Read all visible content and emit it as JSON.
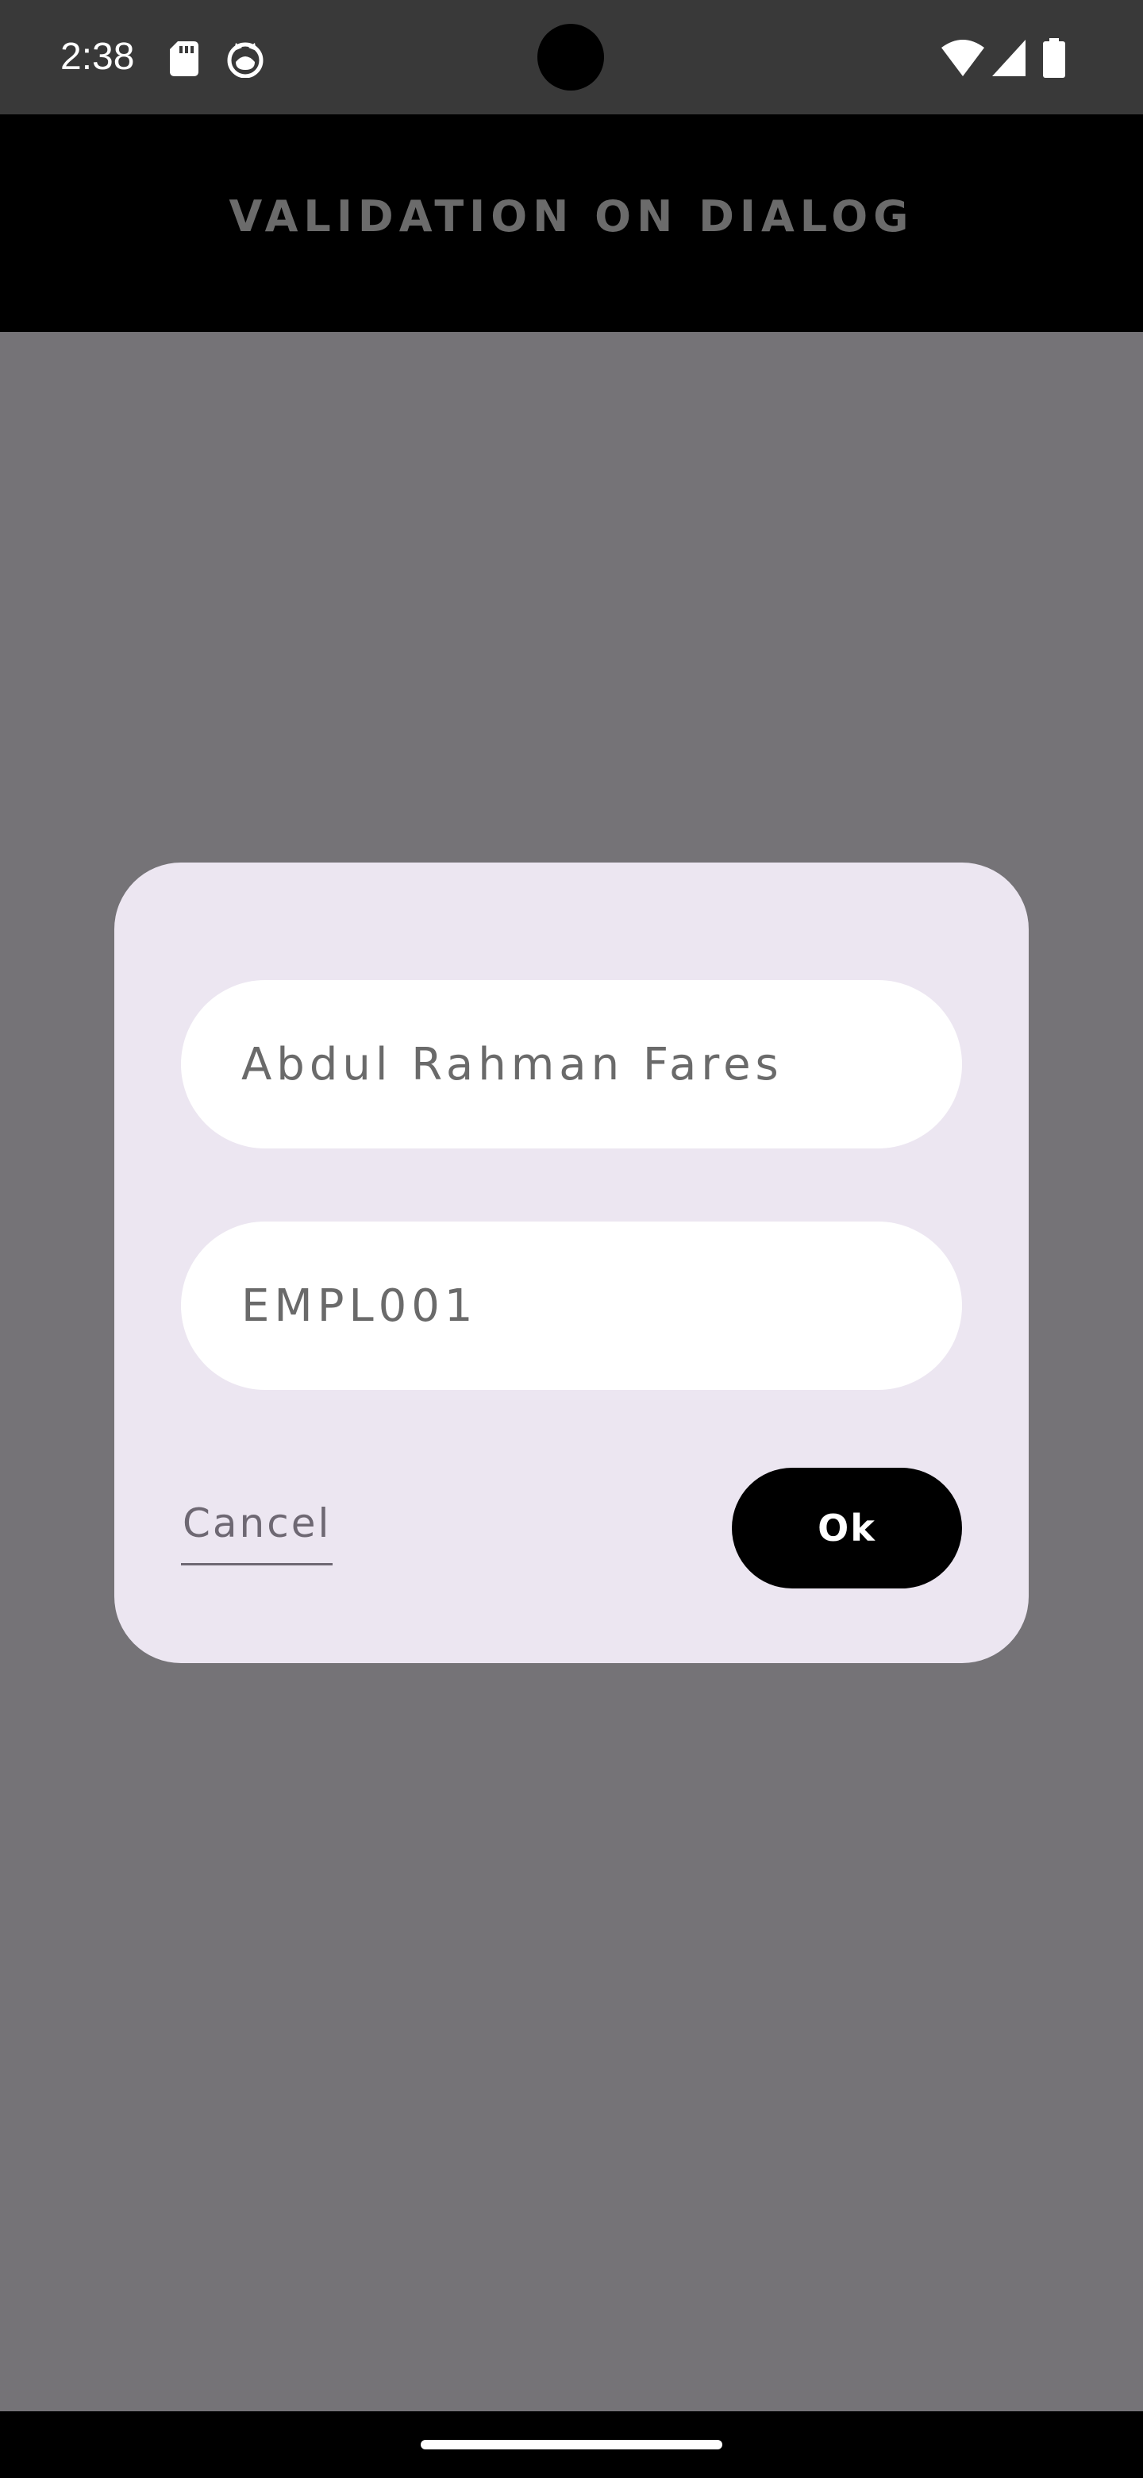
{
  "status_bar": {
    "time": "2:38",
    "icons": [
      "sd-card-icon",
      "cat-face-icon",
      "wifi-icon",
      "cell-signal-icon",
      "battery-icon"
    ]
  },
  "app_bar": {
    "title": "VALIDATION ON DIALOG"
  },
  "dialog": {
    "name_field": {
      "value": "Abdul Rahman Fares"
    },
    "id_field": {
      "value": "EMPL001"
    },
    "cancel_label": "Cancel",
    "ok_label": "Ok"
  },
  "colors": {
    "scrim": "#757377",
    "dialog_background": "#ece6f1",
    "field_background": "#ffffff",
    "ok_button": "#000000",
    "status_bar": "#393939"
  }
}
